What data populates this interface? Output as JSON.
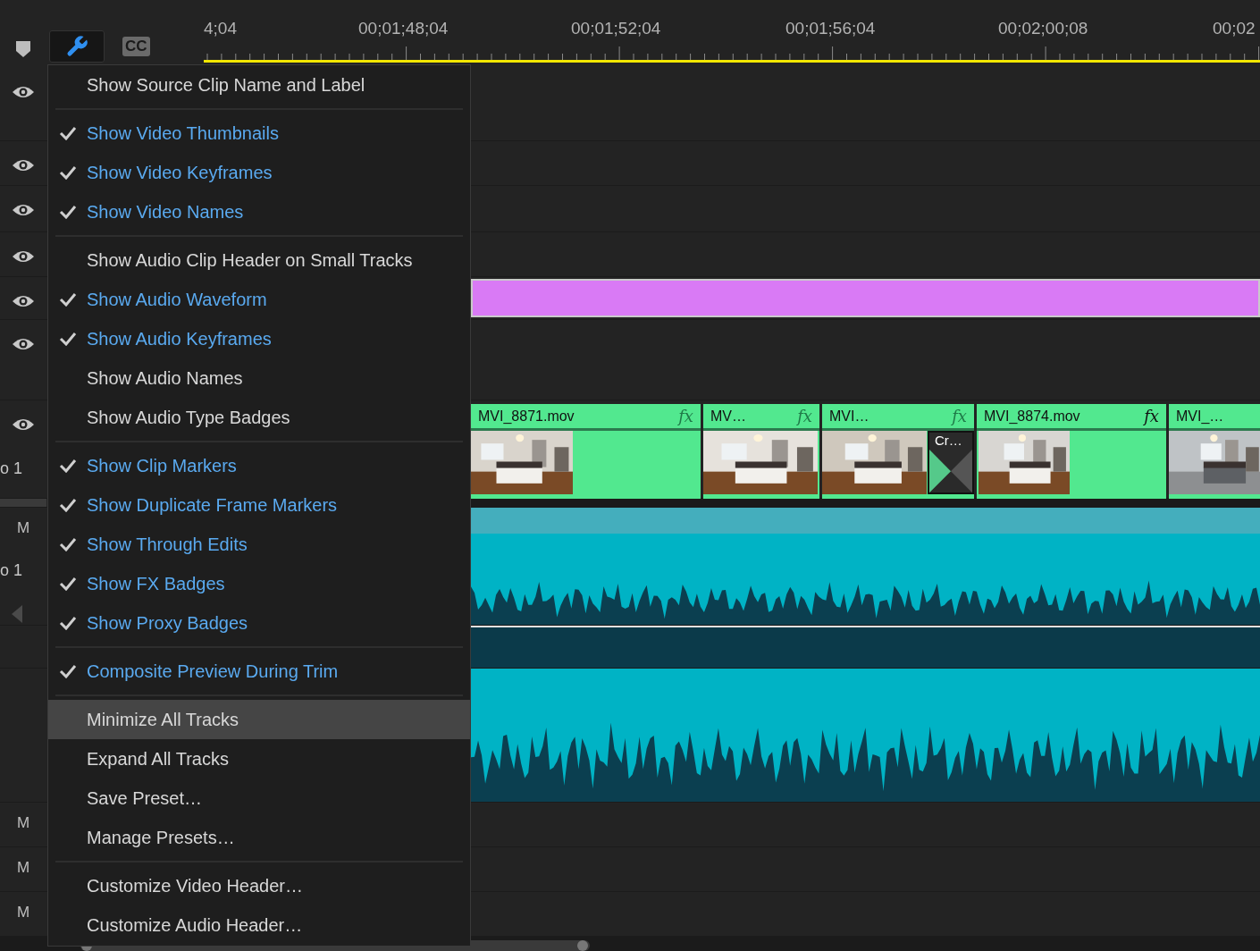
{
  "toolbar": {
    "captions_label": "CC",
    "timecodes": [
      "4;04",
      "00;01;48;04",
      "00;01;52;04",
      "00;01;56;04",
      "00;02;00;08",
      "00;02"
    ]
  },
  "tracks": [
    {
      "kind": "empty",
      "header": {
        "kind": "eye"
      }
    },
    {
      "kind": "empty",
      "header": {
        "kind": "eye"
      }
    },
    {
      "kind": "empty",
      "header": {
        "kind": "eye"
      }
    },
    {
      "kind": "empty",
      "header": {
        "kind": "eye"
      }
    },
    {
      "kind": "graphic",
      "color": "#d97af5",
      "header": {
        "kind": "eye"
      }
    },
    {
      "kind": "empty",
      "header": {
        "kind": "eye"
      }
    },
    {
      "kind": "video",
      "header": {
        "kind": "eye",
        "name": "o 1"
      },
      "clips": [
        {
          "name": "MVI_8871.mov",
          "fx": {
            "label": "fx",
            "applied": false
          }
        },
        {
          "name": "MV…",
          "fx": {
            "label": "fx",
            "applied": false
          }
        },
        {
          "name": "MVI…",
          "fx": {
            "label": "fx",
            "applied": false
          },
          "transition": {
            "label": "Cr…"
          }
        },
        {
          "name": "MVI_8874.mov",
          "fx": {
            "label": "fx",
            "applied": true
          }
        },
        {
          "name": "MVI_…"
        }
      ]
    },
    {
      "kind": "divider"
    },
    {
      "kind": "audio",
      "header": {
        "kind": "mute",
        "text": "M",
        "name": "o 1"
      }
    },
    {
      "kind": "audio_gap",
      "header": {
        "kind": "none"
      }
    },
    {
      "kind": "audio_wave",
      "header": {
        "kind": "none"
      }
    },
    {
      "kind": "empty",
      "header": {
        "kind": "mute",
        "text": "M"
      }
    },
    {
      "kind": "empty",
      "header": {
        "kind": "mute",
        "text": "M"
      }
    },
    {
      "kind": "empty",
      "header": {
        "kind": "mute",
        "text": "M"
      }
    }
  ],
  "menu": {
    "groups": [
      [
        {
          "label": "Show Source Clip Name and Label",
          "checked": false,
          "highlighted": false
        }
      ],
      [
        {
          "label": "Show Video Thumbnails",
          "checked": true,
          "highlighted": false
        },
        {
          "label": "Show Video Keyframes",
          "checked": true,
          "highlighted": false
        },
        {
          "label": "Show Video Names",
          "checked": true,
          "highlighted": false
        }
      ],
      [
        {
          "label": "Show Audio Clip Header on Small Tracks",
          "checked": false,
          "highlighted": false
        },
        {
          "label": "Show Audio Waveform",
          "checked": true,
          "highlighted": false
        },
        {
          "label": "Show Audio Keyframes",
          "checked": true,
          "highlighted": false
        },
        {
          "label": "Show Audio Names",
          "checked": false,
          "highlighted": false
        },
        {
          "label": "Show Audio Type Badges",
          "checked": false,
          "highlighted": false
        }
      ],
      [
        {
          "label": "Show Clip Markers",
          "checked": true,
          "highlighted": false
        },
        {
          "label": "Show Duplicate Frame Markers",
          "checked": true,
          "highlighted": false
        },
        {
          "label": "Show Through Edits",
          "checked": true,
          "highlighted": false
        },
        {
          "label": "Show FX Badges",
          "checked": true,
          "highlighted": false
        },
        {
          "label": "Show Proxy Badges",
          "checked": true,
          "highlighted": false
        }
      ],
      [
        {
          "label": "Composite Preview During Trim",
          "checked": true,
          "highlighted": false
        }
      ],
      [
        {
          "label": "Minimize All Tracks",
          "checked": false,
          "highlighted": true
        },
        {
          "label": "Expand All Tracks",
          "checked": false,
          "highlighted": false
        },
        {
          "label": "Save Preset…",
          "checked": false,
          "highlighted": false
        },
        {
          "label": "Manage Presets…",
          "checked": false,
          "highlighted": false
        }
      ],
      [
        {
          "label": "Customize Video Header…",
          "checked": false,
          "highlighted": false
        },
        {
          "label": "Customize Audio Header…",
          "checked": false,
          "highlighted": false
        }
      ]
    ]
  }
}
